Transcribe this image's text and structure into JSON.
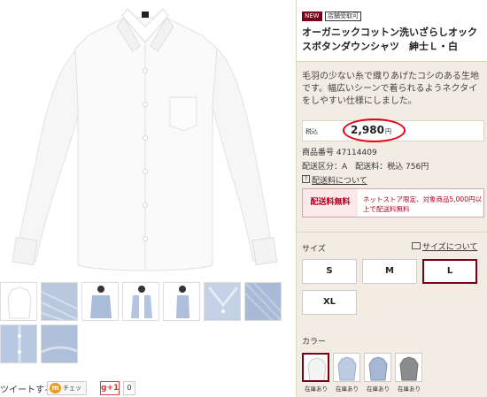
{
  "product": {
    "badge_new": "NEW",
    "badge_store": "店舗受取可",
    "title": "オーガニックコットン洗いざらしオックスボタンダウンシャツ　紳士Ｌ・白",
    "description": "毛羽の少ない糸で織りあげたコシのある生地です。幅広いシーンで着られるようネクタイをしやすい仕様にしました。",
    "tax_label": "税込",
    "price": "2,980",
    "price_unit": "円",
    "product_number": "商品番号 47114409",
    "shipping_info": "配送区分：A　配送料：税込 756円",
    "shipping_link": "配送料について",
    "free_shipping_label": "配送料無料",
    "free_shipping_note": "ネットストア限定、対象商品5,000円以上で配送料無料"
  },
  "sizes": {
    "label": "サイズ",
    "guide_link": "サイズについて",
    "options": [
      "S",
      "M",
      "L",
      "XL"
    ],
    "selected": "L"
  },
  "colors": {
    "label": "カラー",
    "stock_label": "在庫あり",
    "swatches": [
      {
        "name": "white-shirt-icon",
        "color": "#f4f4f4",
        "stock": "在庫あり"
      },
      {
        "name": "light-blue-shirt-icon",
        "color": "#bccbe2",
        "stock": "在庫あり"
      },
      {
        "name": "blue-shirt-icon",
        "color": "#a6b6d4",
        "stock": "在庫あり"
      },
      {
        "name": "gray-shirt-icon",
        "color": "#8c8c8c",
        "stock": "在庫あり"
      }
    ]
  },
  "social": {
    "tweet": "ツイートする",
    "check_label": "チェック",
    "gplus_label": "g+1",
    "gplus_count": "0"
  },
  "theme": {
    "accent": "#7a0019",
    "highlight_circle": "#e60012",
    "panel_bg": "#f2ece2"
  }
}
